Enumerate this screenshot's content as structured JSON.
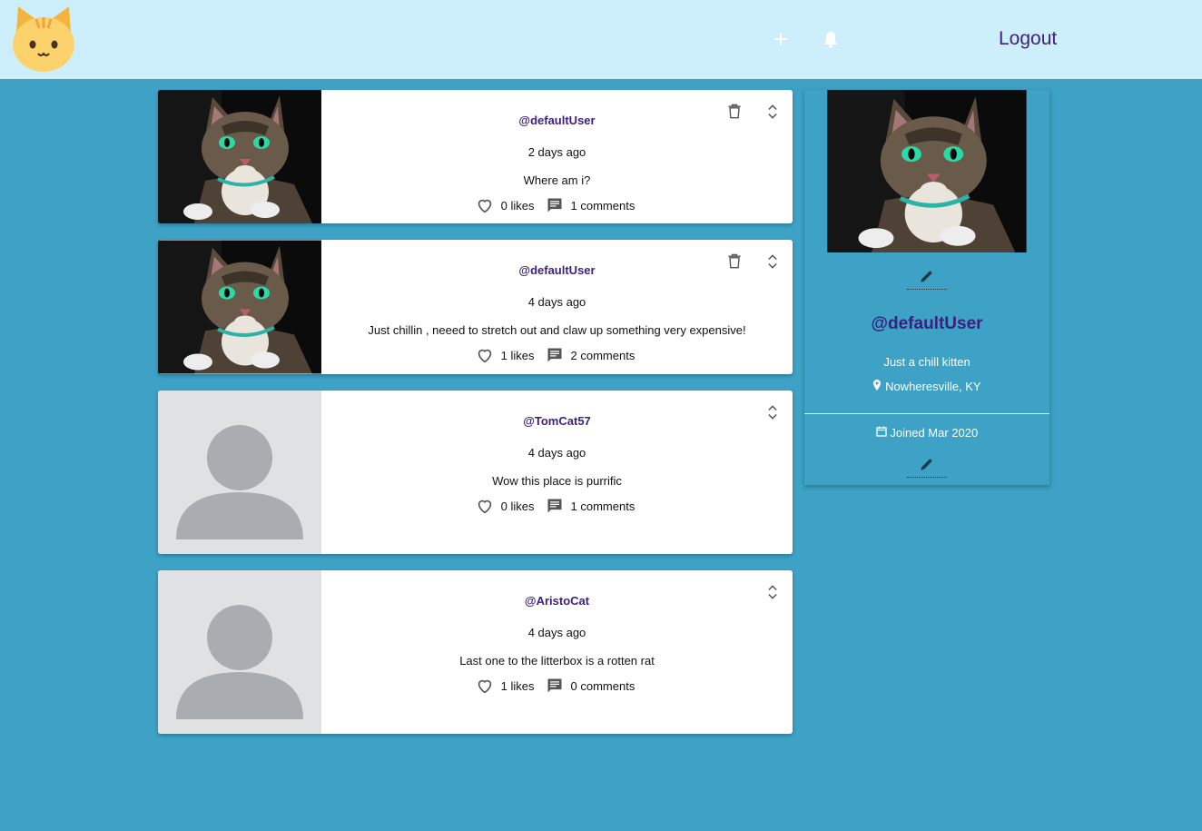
{
  "header": {
    "logout_label": "Logout"
  },
  "posts": [
    {
      "handle": "@defaultUser",
      "time": "2 days ago",
      "body": "Where am i?",
      "likes_label": "0 likes",
      "comments_label": "1 comments"
    },
    {
      "handle": "@defaultUser",
      "time": "4 days ago",
      "body": "Just chillin , neeed to stretch out and claw up something very expensive!",
      "likes_label": "1 likes",
      "comments_label": "2 comments"
    },
    {
      "handle": "@TomCat57",
      "time": "4 days ago",
      "body": "Wow this place is purrific",
      "likes_label": "0 likes",
      "comments_label": "1 comments"
    },
    {
      "handle": "@AristoCat",
      "time": "4 days ago",
      "body": "Last one to the litterbox is a rotten rat",
      "likes_label": "1 likes",
      "comments_label": "0 comments"
    }
  ],
  "profile": {
    "handle": "@defaultUser",
    "bio": "Just a chill kitten",
    "location": "Nowheresville, KY",
    "joined": "Joined Mar 2020"
  },
  "icons": {
    "logo": "cat-face-logo",
    "add": "plus-icon",
    "notifications": "bell-icon",
    "delete": "trash-icon",
    "expand": "unfold-icon",
    "like": "heart-outline-icon",
    "comment": "chat-icon",
    "edit": "pencil-icon",
    "location": "location-pin-icon",
    "calendar": "calendar-icon"
  },
  "colors": {
    "header_bg": "#cdeffb",
    "page_bg": "#3da2c6",
    "handle_purple": "#3d1f7e"
  }
}
